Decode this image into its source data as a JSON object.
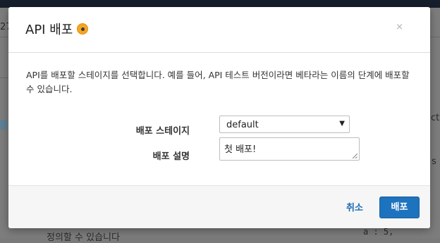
{
  "background": {
    "left_fragment": "27",
    "right_fragment_1": "ct",
    "right_fragment_2": "s",
    "bottom_left_fragment": "정의할 수 있습니다",
    "bottom_right_fragment": "a : 5,"
  },
  "modal": {
    "title": "API 배포",
    "close_symbol": "×",
    "description": "API를 배포할 스테이지를 선택합니다. 예를 들어, API 테스트 버전이라면 베타라는 이름의 단계에 배포할 수 있습니다.",
    "stage_label": "배포 스테이지",
    "stage_value": "default",
    "stage_arrow": "▼",
    "description_label": "배포 설명",
    "description_value": "첫 배포!",
    "cancel_label": "취소",
    "deploy_label": "배포"
  },
  "colors": {
    "primary": "#1e73be",
    "link": "#1a6bb0",
    "info_icon": "#f5a623"
  },
  "icons": {
    "title_icon": "info-dot-icon",
    "close": "close-icon",
    "select_arrow": "chevron-down-icon"
  }
}
